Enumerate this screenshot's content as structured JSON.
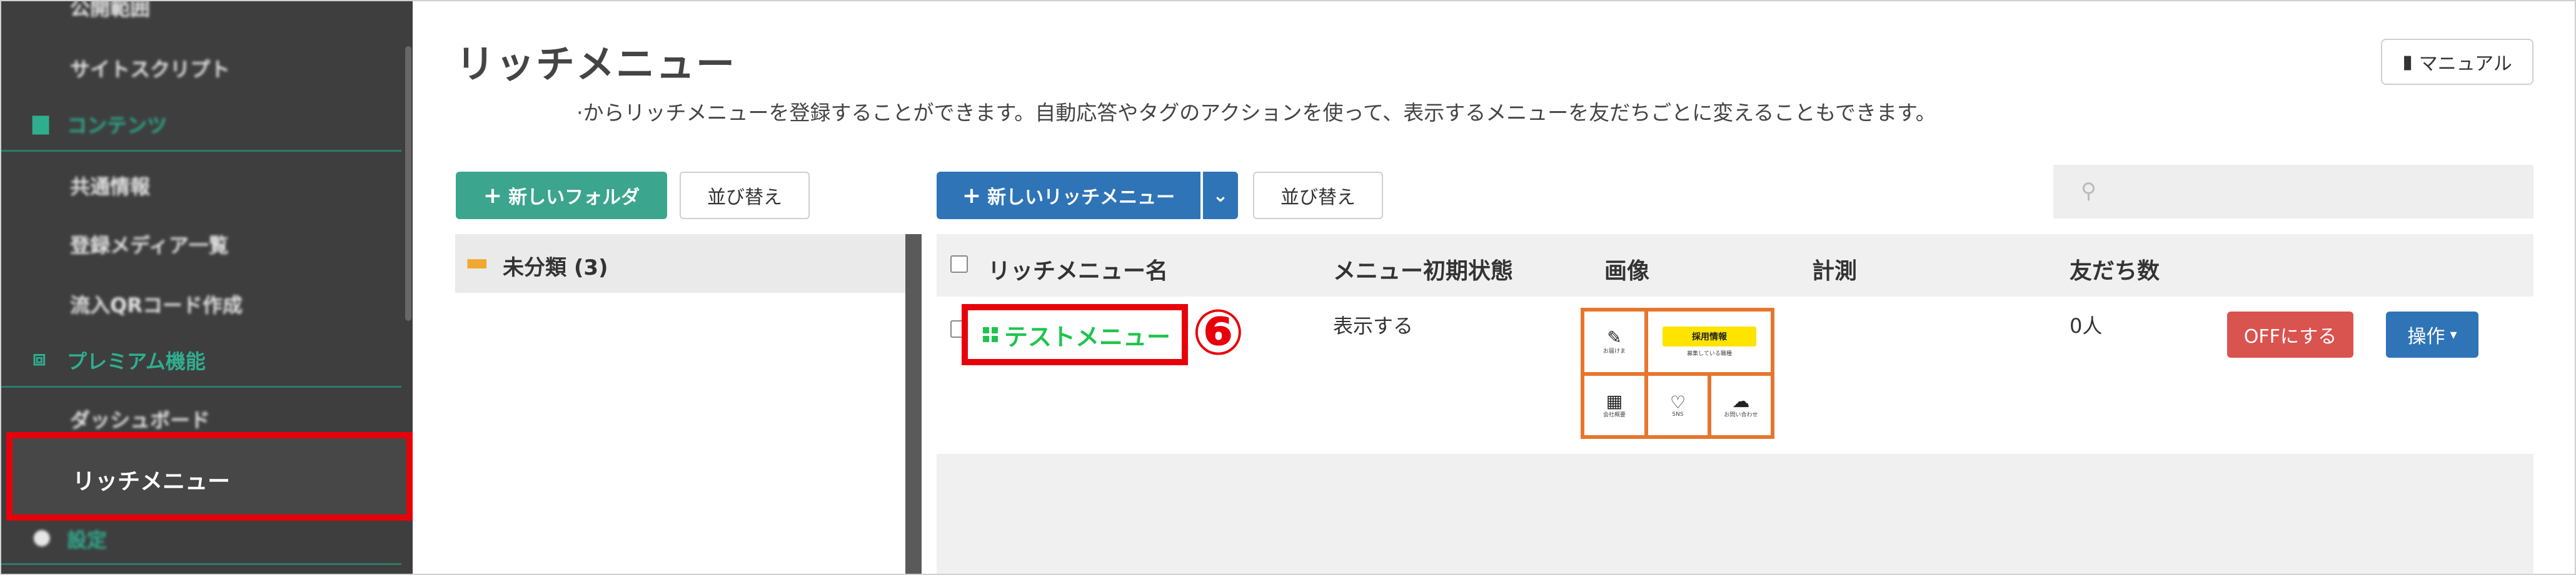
{
  "sidebar": {
    "items": [
      {
        "label": "公開範囲",
        "type": "blurred"
      },
      {
        "label": "サイトスクリプト",
        "type": "blurred"
      },
      {
        "label": "コンテンツ",
        "type": "section_blurred"
      },
      {
        "label": "共通情報",
        "type": "blurred"
      },
      {
        "label": "登録メディア一覧",
        "type": "blurred"
      },
      {
        "label": "流入QRコード作成",
        "type": "blurred"
      },
      {
        "label": "プレミアム機能",
        "type": "section"
      },
      {
        "label": "ダッシュボード",
        "type": "blurred"
      },
      {
        "label": "リッチメニュー",
        "type": "active"
      },
      {
        "label": "設定",
        "type": "section_blurred"
      }
    ]
  },
  "page": {
    "title": "リッチメニュー",
    "description": "·からリッチメニューを登録することができます。自動応答やタグのアクションを使って、表示するメニューを友だちごとに変えることもできます。",
    "manual_label": "マニュアル"
  },
  "toolbar": {
    "new_folder_label": "新しいフォルダ",
    "sort_label": "並び替え",
    "new_richmenu_label": "新しいリッチメニュー",
    "sort2_label": "並び替え",
    "search_placeholder": ""
  },
  "folders": [
    {
      "label": "未分類 (3)"
    }
  ],
  "table": {
    "headers": {
      "name": "リッチメニュー名",
      "initial_state": "メニュー初期状態",
      "image": "画像",
      "measure": "計測",
      "friends": "友だち数"
    },
    "rows": [
      {
        "name": "テストメニュー",
        "initial_state": "表示する",
        "measure": "",
        "friends": "0人",
        "off_label": "OFFにする",
        "action_label": "操作"
      }
    ]
  },
  "thumbnail": {
    "cells": [
      "お届けま",
      "採用情報",
      "会社概要",
      "SNS",
      "お問い合わせ"
    ],
    "cell_subtitle": "募集している職種"
  },
  "annotation": {
    "step_marker": "⑥"
  },
  "colors": {
    "sidebar_bg": "#3e3e3e",
    "accent_green": "#3ba58d",
    "primary_blue": "#2f74b7",
    "highlight_red": "#e8000b",
    "link_green": "#1fc44e",
    "danger_red": "#d9534f",
    "thumb_orange": "#e7762d"
  }
}
